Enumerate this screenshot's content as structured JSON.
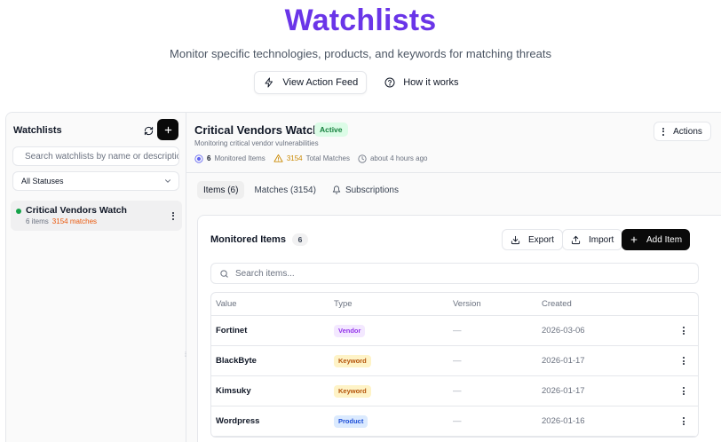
{
  "hero": {
    "title": "Watchlists",
    "subtitle": "Monitor specific technologies, products, and keywords for matching threats",
    "action_feed_label": "View Action Feed",
    "how_it_works_label": "How it works"
  },
  "sidebar": {
    "title": "Watchlists",
    "search_placeholder": "Search watchlists by name or description...",
    "status_filter": "All Statuses",
    "items": [
      {
        "name": "Critical Vendors Watch",
        "items_label": "6 items",
        "matches_label": "3154 matches",
        "status_color": "#16a34a"
      }
    ]
  },
  "watchlist": {
    "title": "Critical Vendors Watch",
    "status": "Active",
    "description": "Monitoring critical vendor vulnerabilities",
    "monitored_count": "6",
    "monitored_label": "Monitored Items",
    "matches_count": "3154",
    "matches_label": "Total Matches",
    "updated": "about 4 hours ago",
    "actions_label": "Actions"
  },
  "tabs": [
    {
      "label": "Items (6)",
      "active": true
    },
    {
      "label": "Matches (3154)",
      "active": false
    },
    {
      "label": "Subscriptions",
      "active": false,
      "icon": "bell-icon"
    }
  ],
  "items_card": {
    "title": "Monitored Items",
    "count": "6",
    "export_label": "Export",
    "import_label": "Import",
    "add_label": "Add Item",
    "search_placeholder": "Search items...",
    "columns": [
      "Value",
      "Type",
      "Version",
      "Created"
    ],
    "rows": [
      {
        "value": "Fortinet",
        "type": "Vendor",
        "version": "—",
        "created": "2026-03-06"
      },
      {
        "value": "BlackByte",
        "type": "Keyword",
        "version": "—",
        "created": "2026-01-17"
      },
      {
        "value": "Kimsuky",
        "type": "Keyword",
        "version": "—",
        "created": "2026-01-17"
      },
      {
        "value": "Wordpress",
        "type": "Product",
        "version": "—",
        "created": "2026-01-16"
      }
    ]
  },
  "colors": {
    "accent": "#6a35e8",
    "vendor_bg": "#f3e8ff",
    "vendor_fg": "#9333ea",
    "keyword_bg": "#fef3c7",
    "keyword_fg": "#b45309",
    "product_bg": "#dbeafe",
    "product_fg": "#1d4ed8"
  }
}
